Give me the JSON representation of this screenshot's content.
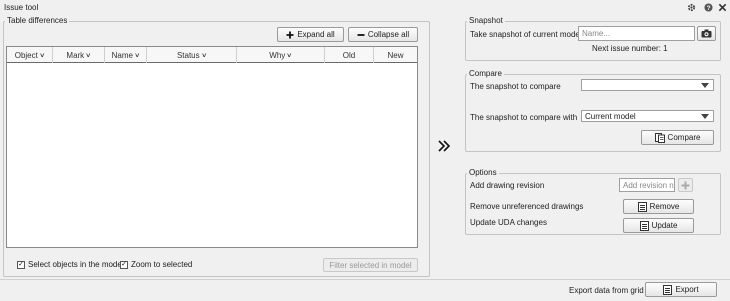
{
  "window": {
    "title": "Issue tool"
  },
  "left": {
    "group_label": "Table differences",
    "expand_all": "Expand all",
    "collapse_all": "Collapse all",
    "columns": [
      {
        "label": "Object",
        "dropdown": true
      },
      {
        "label": "Mark",
        "dropdown": true
      },
      {
        "label": "Name",
        "dropdown": true
      },
      {
        "label": "Status",
        "dropdown": true
      },
      {
        "label": "Why",
        "dropdown": true
      },
      {
        "label": "Old",
        "dropdown": false
      },
      {
        "label": "New",
        "dropdown": false
      }
    ],
    "select_objects_label": "Select objects in the model",
    "select_objects_checked": true,
    "zoom_label": "Zoom to selected",
    "zoom_checked": true,
    "filter_button": "Filter selected in model"
  },
  "snapshot": {
    "group_label": "Snapshot",
    "take_label": "Take snapshot of current model",
    "name_placeholder": "Name...",
    "next_issue": "Next issue number: 1"
  },
  "compare": {
    "group_label": "Compare",
    "snapshot_to_compare_label": "The snapshot to compare",
    "snapshot_to_compare_value": "",
    "compare_with_label": "The snapshot to compare with",
    "compare_with_value": "Current model",
    "compare_button": "Compare"
  },
  "options": {
    "group_label": "Options",
    "add_revision_label": "Add drawing revision",
    "revision_placeholder": "Add revision n",
    "remove_label": "Remove unreferenced drawings",
    "remove_button": "Remove",
    "update_label": "Update UDA changes",
    "update_button": "Update"
  },
  "footer": {
    "export_label": "Export data from grid",
    "export_button": "Export"
  },
  "icons": [
    "gear-icon",
    "help-icon",
    "close-icon",
    "plus-icon",
    "minus-icon",
    "camera-icon",
    "double-chevron-right-icon",
    "document-icon"
  ]
}
